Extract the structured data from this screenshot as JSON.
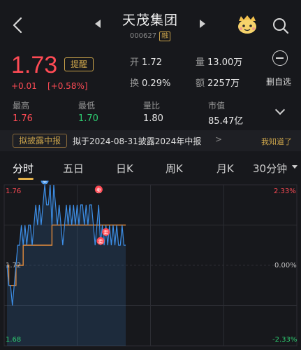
{
  "header": {
    "title": "天茂集团",
    "code": "000627",
    "tag": "融"
  },
  "quote": {
    "price": "1.73",
    "change": "+0.01",
    "change_pct": "[+0.58%]",
    "remind_label": "提醒",
    "open_label": "开",
    "open_value": "1.72",
    "volume_label": "量",
    "volume_value": "13.00万",
    "turnover_label": "换",
    "turnover_value": "0.29%",
    "amount_label": "额",
    "amount_value": "2257万",
    "remove_label": "删自选"
  },
  "stats": {
    "high_label": "最高",
    "high_value": "1.76",
    "low_label": "最低",
    "low_value": "1.70",
    "ratio_label": "量比",
    "ratio_value": "1.80",
    "mcap_label": "市值",
    "mcap_value": "85.47亿"
  },
  "banner": {
    "tag": "拟披露中报",
    "text": "拟于2024-08-31披露2024年中报",
    "arrow": ">",
    "ack": "我知道了"
  },
  "tabs": {
    "intraday": "分时",
    "five_day": "五日",
    "daily": "日K",
    "weekly": "周K",
    "monthly": "月K",
    "minute30": "30分钟"
  },
  "colors": {
    "up": "#ff4b55",
    "down": "#2ecc71",
    "gold": "#c9a24a",
    "price_line": "#3d8fe8",
    "avg_line": "#e08a3c"
  },
  "chart_data": {
    "type": "line",
    "ylim": [
      1.68,
      1.76
    ],
    "left_labels": {
      "top": "1.76",
      "mid": "1.72",
      "bottom": "1.68"
    },
    "right_labels": {
      "top": "2.33%",
      "mid": "0.00%",
      "bottom": "-2.33%"
    },
    "markers": [
      {
        "label": "买",
        "color": "#3d8fe8"
      },
      {
        "label": "卖",
        "color": "#ff4b55"
      },
      {
        "label": "卖",
        "color": "#ff4b55"
      },
      {
        "label": "卖",
        "color": "#ff4b55"
      }
    ],
    "series": [
      {
        "values": [
          1.72,
          1.71,
          1.71,
          1.7,
          1.71,
          1.72,
          1.73,
          1.73,
          1.74,
          1.73,
          1.74,
          1.73,
          1.74,
          1.74,
          1.73,
          1.74,
          1.75,
          1.74,
          1.75,
          1.74,
          1.75,
          1.76,
          1.75,
          1.75,
          1.76,
          1.74,
          1.76,
          1.75,
          1.74,
          1.75,
          1.74,
          1.73,
          1.74,
          1.75,
          1.74,
          1.75,
          1.74,
          1.75,
          1.74,
          1.75,
          1.74,
          1.75,
          1.75,
          1.74,
          1.75,
          1.74,
          1.75,
          1.75,
          1.74,
          1.73,
          1.74,
          1.75,
          1.73,
          1.74,
          1.73,
          1.74,
          1.73,
          1.74,
          1.73,
          1.74,
          1.73,
          1.74,
          1.73,
          1.73,
          1.74,
          1.73,
          1.73
        ]
      },
      {
        "values": [
          1.72,
          1.71,
          1.71,
          1.71,
          1.71,
          1.72,
          1.72,
          1.72,
          1.72,
          1.73,
          1.73,
          1.73,
          1.73,
          1.73,
          1.73,
          1.73,
          1.73,
          1.73,
          1.73,
          1.73,
          1.73,
          1.73,
          1.73,
          1.73,
          1.73,
          1.74,
          1.74,
          1.74,
          1.74,
          1.74,
          1.74,
          1.74,
          1.74,
          1.74,
          1.74,
          1.74,
          1.74,
          1.74,
          1.74,
          1.74,
          1.74,
          1.74,
          1.74,
          1.74,
          1.74,
          1.74,
          1.74,
          1.74,
          1.74,
          1.74,
          1.74,
          1.74,
          1.74,
          1.74,
          1.74,
          1.74,
          1.74,
          1.74,
          1.74,
          1.74,
          1.74,
          1.74,
          1.74,
          1.74,
          1.74,
          1.74,
          1.74
        ]
      }
    ]
  }
}
